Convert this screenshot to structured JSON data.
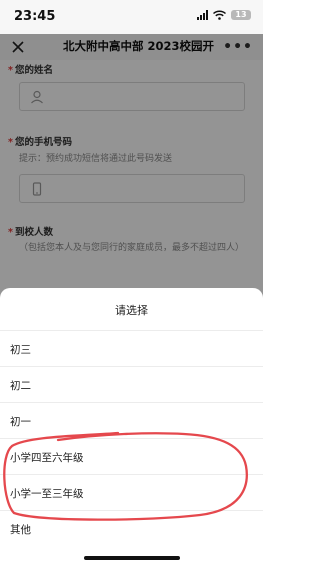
{
  "status_bar": {
    "time": "23:45",
    "battery": "13"
  },
  "nav": {
    "title": "北大附中高中部 2023校园开"
  },
  "form": {
    "name_label": "您的姓名",
    "phone_label": "您的手机号码",
    "phone_hint": "提示：预约成功短信将通过此号码发送",
    "visitors_label": "到校人数",
    "visitors_hint": "（包括您本人及与您同行的家庭成员，最多不超过四人）"
  },
  "picker": {
    "title": "请选择",
    "options": [
      "初三",
      "初二",
      "初一",
      "小学四至六年级",
      "小学一至三年级",
      "其他"
    ]
  },
  "colors": {
    "required_star": "#e03a3a",
    "annotation": "#e5484d",
    "overlay": "rgba(0,0,0,0.42)"
  },
  "icons": [
    "close-icon",
    "more-icon",
    "person-icon",
    "phone-icon",
    "signal-icon",
    "wifi-icon",
    "battery-icon"
  ]
}
